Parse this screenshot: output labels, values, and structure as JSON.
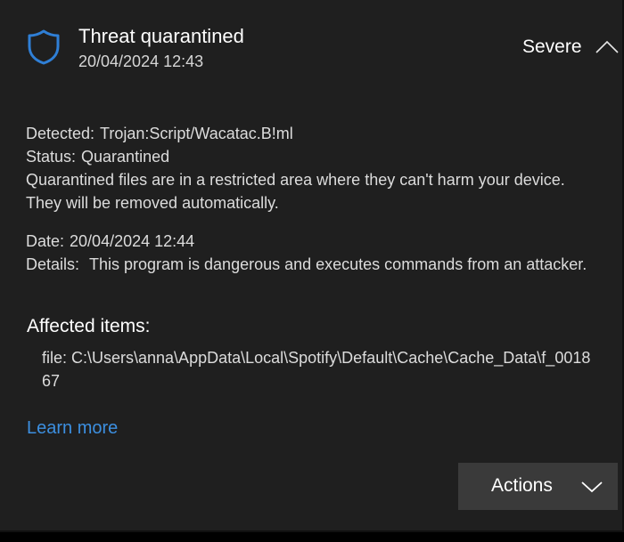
{
  "header": {
    "title": "Threat quarantined",
    "timestamp": "20/04/2024 12:43",
    "severity": "Severe",
    "shield_icon": "shield-icon",
    "collapse_icon": "chevron-up-icon"
  },
  "detection": {
    "detected_label": "Detected:",
    "detected_value": "Trojan:Script/Wacatac.B!ml",
    "status_label": "Status:",
    "status_value": "Quarantined",
    "description_line1": "Quarantined files are in a restricted area where they can't harm your device.",
    "description_line2": "They will be removed automatically."
  },
  "info": {
    "date_label": "Date:",
    "date_value": "20/04/2024 12:44",
    "details_label": "Details:",
    "details_value": "This program is dangerous and executes commands from an attacker."
  },
  "affected": {
    "heading": "Affected items:",
    "items": [
      "file: C:\\Users\\anna\\AppData\\Local\\Spotify\\Default\\Cache\\Cache_Data\\f_001867"
    ]
  },
  "links": {
    "learn_more": "Learn more"
  },
  "actions": {
    "label": "Actions",
    "chevron_icon": "chevron-down-icon"
  },
  "colors": {
    "panel_background": "#1f1f1f",
    "accent_link": "#3c8fe0",
    "shield": "#2f7fd6",
    "button_background": "#3a3a3a"
  }
}
